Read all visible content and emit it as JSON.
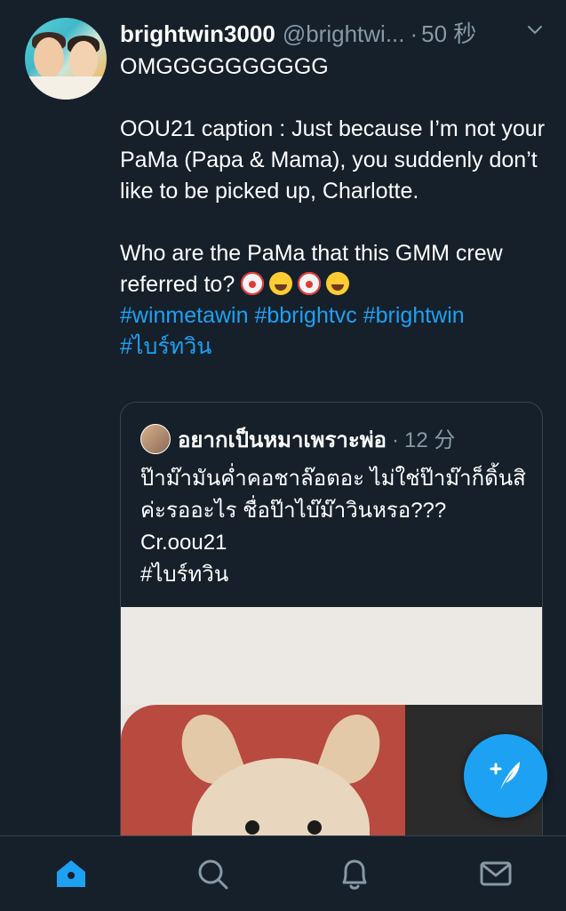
{
  "tweet": {
    "display_name": "brightwin3000",
    "handle": "@brightwi...",
    "dot": "·",
    "time": "50 秒",
    "lines": [
      "OMGGGGGGGGGG",
      "",
      "OOU21 caption : Just because I’m not your PaMa (Papa & Mama), you suddenly don’t like to be picked up, Charlotte.",
      "",
      "Who are the PaMa that this GMM crew referred to?"
    ],
    "emojis": [
      "clown-face",
      "face-with-tears-of-joy",
      "clown-face",
      "rolling-on-the-floor-laughing"
    ],
    "hashtags_line1": "#winmetawin #bbrightvc #brightwin",
    "hashtags_line2": "#ไบร์ทวิน"
  },
  "quote": {
    "display_name": "อยากเป็นหมาเพราะพ่อ",
    "dot": "·",
    "time": "12 分",
    "lines": [
      "ป๊าม๊ามันค่ำคอชาล๊อตอะ ไม่ใช่ป๊าม๊าก็ดิ้นสิค่ะรออะไร ชื่อป๊าไบ๊ม๊าวินหรอ???",
      "Cr.oou21",
      "#ไบร์ทวิน"
    ]
  },
  "fab": {
    "icon": "compose-feather-icon"
  },
  "tabbar": {
    "items": [
      "home-icon",
      "search-icon",
      "notifications-icon",
      "messages-icon"
    ],
    "active": "home-icon",
    "active_color": "#1da1f2",
    "inactive_color": "#8899a6"
  },
  "colors": {
    "background": "#15202b",
    "accent": "#1da1f2",
    "muted": "#8899a6",
    "border": "#38444d"
  }
}
